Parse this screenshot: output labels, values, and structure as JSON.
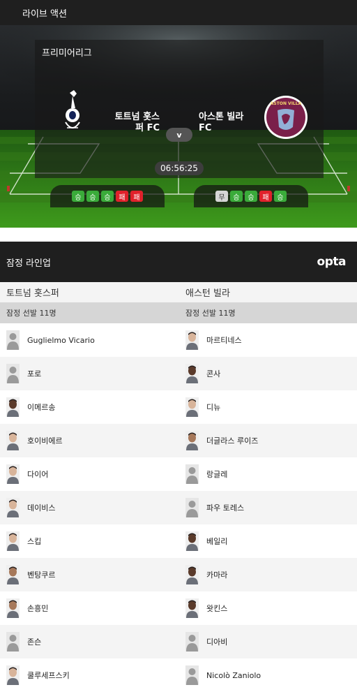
{
  "header": {
    "title": "라이브 액션"
  },
  "match": {
    "league": "프리미어리그",
    "home": {
      "name_line1": "토트넘 홋스",
      "name_line2": "퍼 FC",
      "logo": "tottenham-crest-icon"
    },
    "away": {
      "name_line1": "아스톤 빌라",
      "name_line2": "FC",
      "logo": "aston-villa-crest-icon",
      "logo_text": "ASTON VILLA"
    },
    "vs": "v",
    "time": "06:56:25",
    "home_form": [
      {
        "label": "승",
        "result": "W"
      },
      {
        "label": "승",
        "result": "W"
      },
      {
        "label": "승",
        "result": "W"
      },
      {
        "label": "패",
        "result": "L"
      },
      {
        "label": "패",
        "result": "L"
      }
    ],
    "away_form": [
      {
        "label": "무",
        "result": "D"
      },
      {
        "label": "승",
        "result": "W"
      },
      {
        "label": "승",
        "result": "W"
      },
      {
        "label": "패",
        "result": "L"
      },
      {
        "label": "승",
        "result": "W"
      }
    ],
    "colors": {
      "win": "#3aab3a",
      "loss": "#e0212b",
      "draw": "#d6d6d6",
      "villa_claret": "#7a1f4a",
      "villa_blue": "#95bfe5",
      "spurs_navy": "#132257"
    }
  },
  "lineup": {
    "title": "잠정 라인업",
    "provider_logo": "opta",
    "home_team": "토트넘 홋스퍼",
    "away_team": "애스턴 빌라",
    "home_starters_label": "잠정 선발 11명",
    "away_starters_label": "잠정 선발 11명",
    "home_players": [
      {
        "name": "Guglielmo Vicario",
        "photo": "silhouette"
      },
      {
        "name": "포로",
        "photo": "silhouette"
      },
      {
        "name": "이메르송",
        "photo": "face-dark"
      },
      {
        "name": "호이비에르",
        "photo": "face-light"
      },
      {
        "name": "다이어",
        "photo": "face-light"
      },
      {
        "name": "데이비스",
        "photo": "face-light"
      },
      {
        "name": "스킵",
        "photo": "face-light"
      },
      {
        "name": "벤탕쿠르",
        "photo": "face-medium"
      },
      {
        "name": "손흥민",
        "photo": "face-medium"
      },
      {
        "name": "존슨",
        "photo": "silhouette"
      },
      {
        "name": "쿨루세프스키",
        "photo": "face-light"
      }
    ],
    "away_players": [
      {
        "name": "마르티네스",
        "photo": "face-light"
      },
      {
        "name": "콘사",
        "photo": "face-dark"
      },
      {
        "name": "디뉴",
        "photo": "face-light"
      },
      {
        "name": "더글라스 루이즈",
        "photo": "face-medium"
      },
      {
        "name": "랑글레",
        "photo": "silhouette"
      },
      {
        "name": "파우 토레스",
        "photo": "silhouette"
      },
      {
        "name": "베일리",
        "photo": "face-dark"
      },
      {
        "name": "카마라",
        "photo": "face-dark"
      },
      {
        "name": "왓킨스",
        "photo": "face-dark"
      },
      {
        "name": "디아비",
        "photo": "silhouette"
      },
      {
        "name": "Nicolò Zaniolo",
        "photo": "silhouette"
      }
    ]
  }
}
